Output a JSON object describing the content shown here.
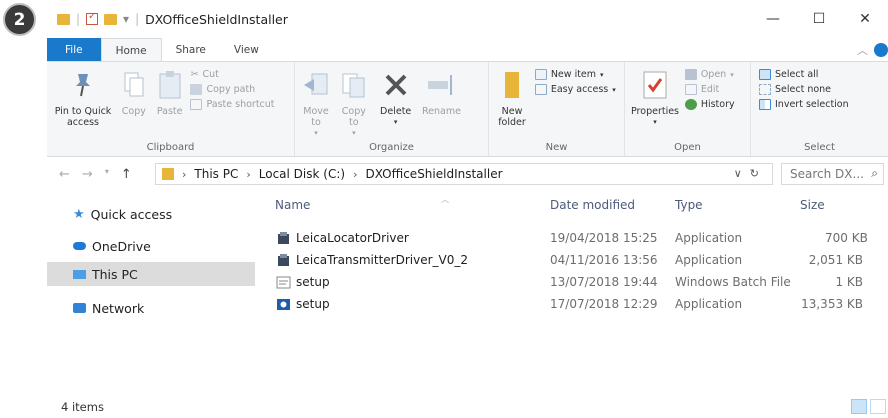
{
  "step_badge": "2",
  "window": {
    "title": "DXOfficeShieldInstaller",
    "qat_dropdown": "▾",
    "controls": {
      "minimize": "—",
      "maximize": "☐",
      "close": "✕"
    }
  },
  "tabs": [
    {
      "label": "File",
      "kind": "file"
    },
    {
      "label": "Home",
      "kind": "active"
    },
    {
      "label": "Share",
      "kind": "normal"
    },
    {
      "label": "View",
      "kind": "normal"
    }
  ],
  "ribbon": {
    "clipboard": {
      "label": "Clipboard",
      "pin": "Pin to Quick access",
      "copy": "Copy",
      "paste": "Paste",
      "cut": "Cut",
      "copy_path": "Copy path",
      "paste_shortcut": "Paste shortcut"
    },
    "organize": {
      "label": "Organize",
      "move_to": "Move to",
      "copy_to": "Copy to",
      "delete": "Delete",
      "rename": "Rename"
    },
    "new": {
      "label": "New",
      "new_folder": "New folder",
      "new_item": "New item",
      "easy_access": "Easy access"
    },
    "open": {
      "label": "Open",
      "properties": "Properties",
      "open": "Open",
      "edit": "Edit",
      "history": "History"
    },
    "select": {
      "label": "Select",
      "select_all": "Select all",
      "select_none": "Select none",
      "invert": "Invert selection"
    }
  },
  "address": {
    "crumbs": [
      "This PC",
      "Local Disk (C:)",
      "DXOfficeShieldInstaller"
    ],
    "search_placeholder": "Search DX..."
  },
  "nav": [
    {
      "label": "Quick access",
      "icon": "star-icon",
      "color": "#3c8ad8"
    },
    {
      "label": "OneDrive",
      "icon": "cloud-icon",
      "color": "#1f7ad6"
    },
    {
      "label": "This PC",
      "icon": "computer-icon",
      "color": "#4aa0e6"
    },
    {
      "label": "Network",
      "icon": "network-icon",
      "color": "#2f85d4"
    }
  ],
  "columns": {
    "name": "Name",
    "date": "Date modified",
    "type": "Type",
    "size": "Size"
  },
  "files": [
    {
      "name": "LeicaLocatorDriver",
      "date": "19/04/2018 15:25",
      "type": "Application",
      "size": "700 KB",
      "icon": "installer-icon"
    },
    {
      "name": "LeicaTransmitterDriver_V0_2",
      "date": "04/11/2016 13:56",
      "type": "Application",
      "size": "2,051 KB",
      "icon": "installer-icon"
    },
    {
      "name": "setup",
      "date": "13/07/2018 19:44",
      "type": "Windows Batch File",
      "size": "1 KB",
      "icon": "batch-file-icon"
    },
    {
      "name": "setup",
      "date": "17/07/2018 12:29",
      "type": "Application",
      "size": "13,353 KB",
      "icon": "setup-app-icon"
    }
  ],
  "status": {
    "items": "4 items"
  },
  "colors": {
    "accent": "#1979ca",
    "selected_nav": "#dcdcdc",
    "folder": "#e7b53a"
  }
}
